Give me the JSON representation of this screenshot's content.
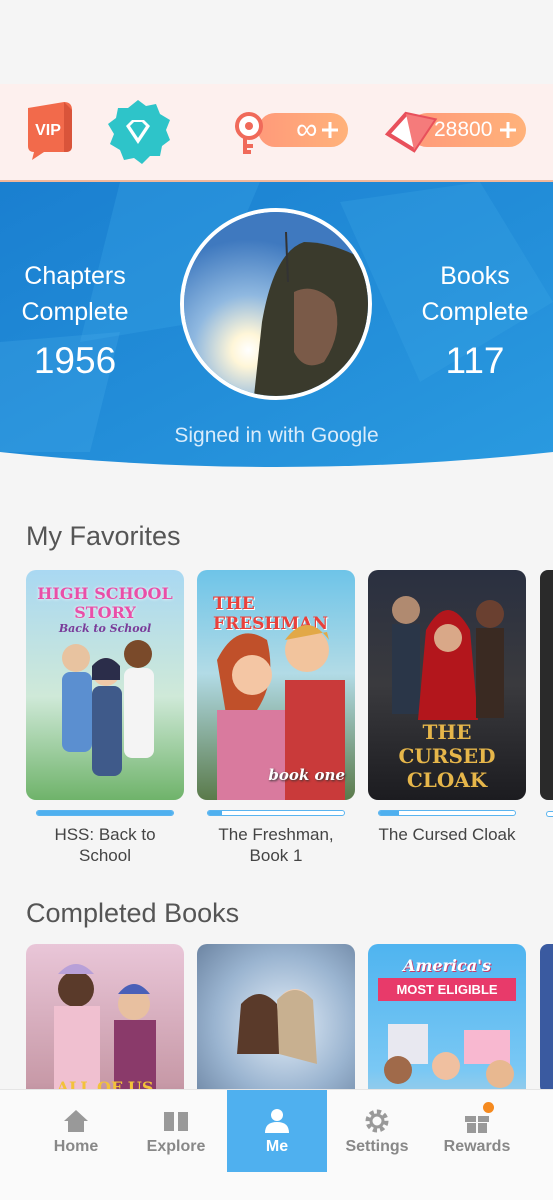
{
  "header": {
    "vip_label": "VIP",
    "keys_value": "∞",
    "gems_value": "28800",
    "colors": {
      "topbar_bg": "#fdf0ee",
      "pill": "#ff9a7a",
      "hero_blue": "#1f8fd8"
    }
  },
  "profile": {
    "chapters_label_1": "Chapters",
    "chapters_label_2": "Complete",
    "chapters_value": "1956",
    "books_label_1": "Books",
    "books_label_2": "Complete",
    "books_value": "117",
    "signed_in_text": "Signed in with Google"
  },
  "favorites": {
    "title": "My Favorites",
    "books": [
      {
        "title_line1": "HSS: Back to",
        "title_line2": "School",
        "progress": 1.0,
        "cover_text": "HIGH SCHOOL STORY",
        "cover_sub": "Back to School"
      },
      {
        "title_line1": "The Freshman,",
        "title_line2": "Book 1",
        "progress": 0.1,
        "cover_text": "THE FRESHMAN",
        "cover_sub": "book one"
      },
      {
        "title_line1": "The Cursed Cloak",
        "title_line2": "",
        "progress": 0.15,
        "cover_text": "THE CURSED CLOAK",
        "cover_sub": ""
      }
    ]
  },
  "completed": {
    "title": "Completed Books",
    "books": [
      {
        "cover_text": "ALL OF US"
      },
      {
        "cover_text": ""
      },
      {
        "cover_text": "America's",
        "cover_sub": "MOST ELIGIBLE"
      }
    ]
  },
  "nav": {
    "items": [
      {
        "label": "Home",
        "icon": "home-icon"
      },
      {
        "label": "Explore",
        "icon": "book-icon"
      },
      {
        "label": "Me",
        "icon": "person-icon"
      },
      {
        "label": "Settings",
        "icon": "gear-icon"
      },
      {
        "label": "Rewards",
        "icon": "gift-icon"
      }
    ],
    "active": "Me"
  }
}
